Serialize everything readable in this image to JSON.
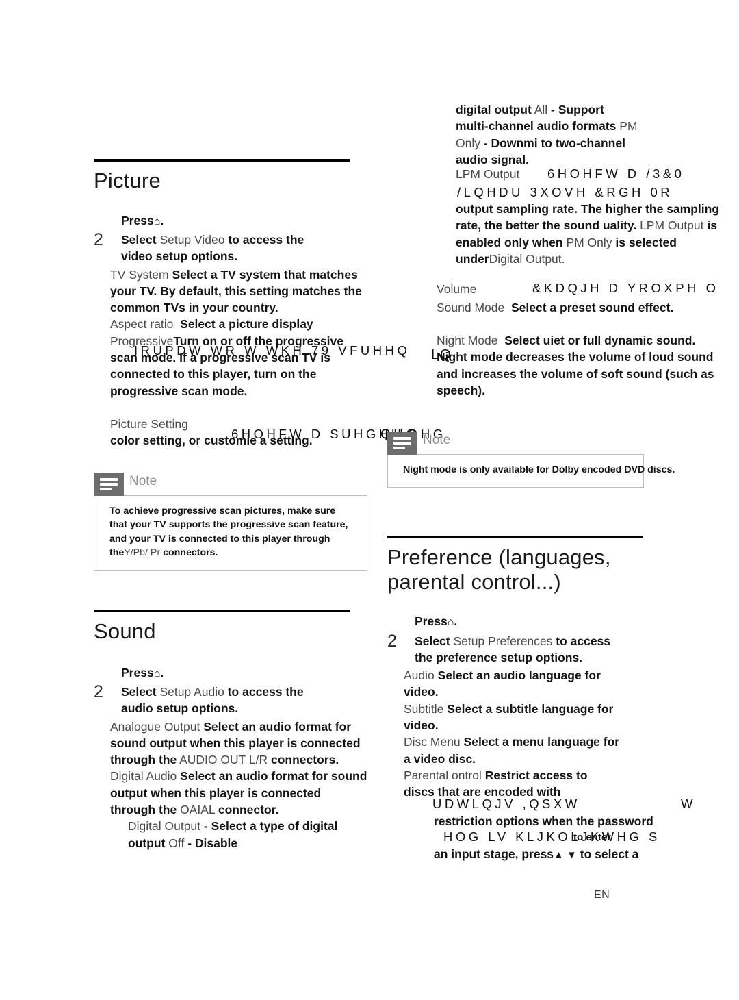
{
  "page": {
    "footer_label": "EN"
  },
  "sections": {
    "picture": {
      "title": "Picture",
      "step1": {
        "press_label": "Press",
        "icon": "home-icon",
        "period": "."
      },
      "step2": {
        "num": "2",
        "select_label": "Select",
        "path_a": "Setup",
        "path_b": "Video",
        "tail": "to access the",
        "line2": "video setup options."
      },
      "options": [
        {
          "label": "TV System",
          "desc": "Select a TV system that matches your TV. By default, this setting matches the common TVs in your country."
        },
        {
          "label": "Aspect ratio",
          "desc": "Select a picture display",
          "garbled": "IRUPDW WR  W WKH 79 VFUHHQ"
        },
        {
          "label": "Progressive",
          "desc": "Turn on or off the progressive scan mode. If a progressive scan TV is connected to this player, turn on the progressive scan mode."
        },
        {
          "label": "Picture Setting",
          "garbled": "6HOHFW D SUHGHILQHG",
          "desc": "color setting, or customie a setting."
        }
      ],
      "note": {
        "heading": "Note",
        "icon": "note-icon",
        "text_1": "To achieve progressive scan pictures, make sure that your TV supports the progressive scan feature, and your TV is connected to this player through the",
        "text_light": "Y/Pb/ Pr",
        "text_2": "connectors."
      }
    },
    "sound": {
      "title": "Sound",
      "step1": {
        "press_label": "Press",
        "icon": "home-icon",
        "period": "."
      },
      "step2": {
        "num": "2",
        "select_label": "Select",
        "path_a": "Setup",
        "path_b": "Audio",
        "tail": "to access the",
        "line2": "audio setup options."
      },
      "options": [
        {
          "label": "Analogue Output",
          "desc_a": "Select an audio format for sound output when this player is connected through the",
          "label_b": "AUDIO OUT L/R",
          "desc_b": "connectors."
        },
        {
          "label": "Digital Audio",
          "desc_a": "Select an audio format for sound output when this player is connected through the",
          "label_b": "OAIAL",
          "desc_b": "connector."
        }
      ],
      "sub_options": [
        {
          "label": "Digital Output",
          "desc_a": "- Select a type of digital output",
          "label_b": "Off",
          "desc_b": "- Disable"
        }
      ]
    },
    "sound_cont": {
      "line1_a": "digital output",
      "line1_b": "All",
      "line1_c": "- Support",
      "line2_a": "multi-channel audio formats",
      "line2_b": "PM",
      "line3_a": "Only",
      "line3_b": "- Downmi to two-channel",
      "line4": "audio signal.",
      "lpm_label": "LPM Output",
      "lpm_garbled_1": "6HOHFW D /3&0",
      "lpm_garbled_2": "/LQHDU 3XOVH &RGH 0R",
      "lpm_desc_1": "output sampling rate. The higher the sampling rate, the better the",
      "lpm_desc_2a": "sound uality.",
      "lpm_desc_2b": "LPM Output",
      "lpm_desc_2c": "is",
      "lpm_desc_3a": "enabled only when",
      "lpm_desc_3b": "PM Only",
      "lpm_desc_3c": "is",
      "lpm_desc_4a": "selected under",
      "lpm_desc_4b": "Digital Output.",
      "volume_label": "Volume",
      "volume_garbled": "&KDQJH D YROXPH O",
      "sound_mode_label": "Sound Mode",
      "sound_mode_desc": "Select a preset sound effect.",
      "night_label": "Night Mode",
      "night_desc_head": "Select uiet or full",
      "night_desc_body": "dynamic sound. Night mode decreases the volume of loud sound and increases the volume of soft sound (such as speech).",
      "night_artifact": "LQ",
      "note": {
        "heading": "Note",
        "icon": "note-icon",
        "text": "Night mode is only available for Dolby encoded DVD discs.",
        "overflow_garbled": "QHG"
      }
    },
    "preference": {
      "title": "Preference (languages,\nparental control...)",
      "step1": {
        "press_label": "Press",
        "icon": "home-icon",
        "period": "."
      },
      "step2": {
        "num": "2",
        "select_label": "Select",
        "path_a": "Setup",
        "path_b": "Preferences",
        "tail": "to access",
        "line2": "the preference setup options."
      },
      "options": [
        {
          "label": "Audio",
          "desc": "Select an audio language for video."
        },
        {
          "label": "Subtitle",
          "desc": "Select a subtitle language for video."
        },
        {
          "label": "Disc Menu",
          "desc": "Select a menu language for a video disc."
        },
        {
          "label": "Parental ontrol",
          "desc": "Restrict access to discs that are encoded with",
          "garbled_1": "UDWLQJV  ,QSXW",
          "garbled_1_tail": "W",
          "desc_2": "restriction options when the password",
          "garbled_2": "HOG LV KLJKOLJKWHG S",
          "artifact_2": "to enter",
          "desc_3a": "an input stage, press",
          "arrows": "▲ ▼",
          "desc_3b": "to select a"
        }
      ]
    }
  }
}
